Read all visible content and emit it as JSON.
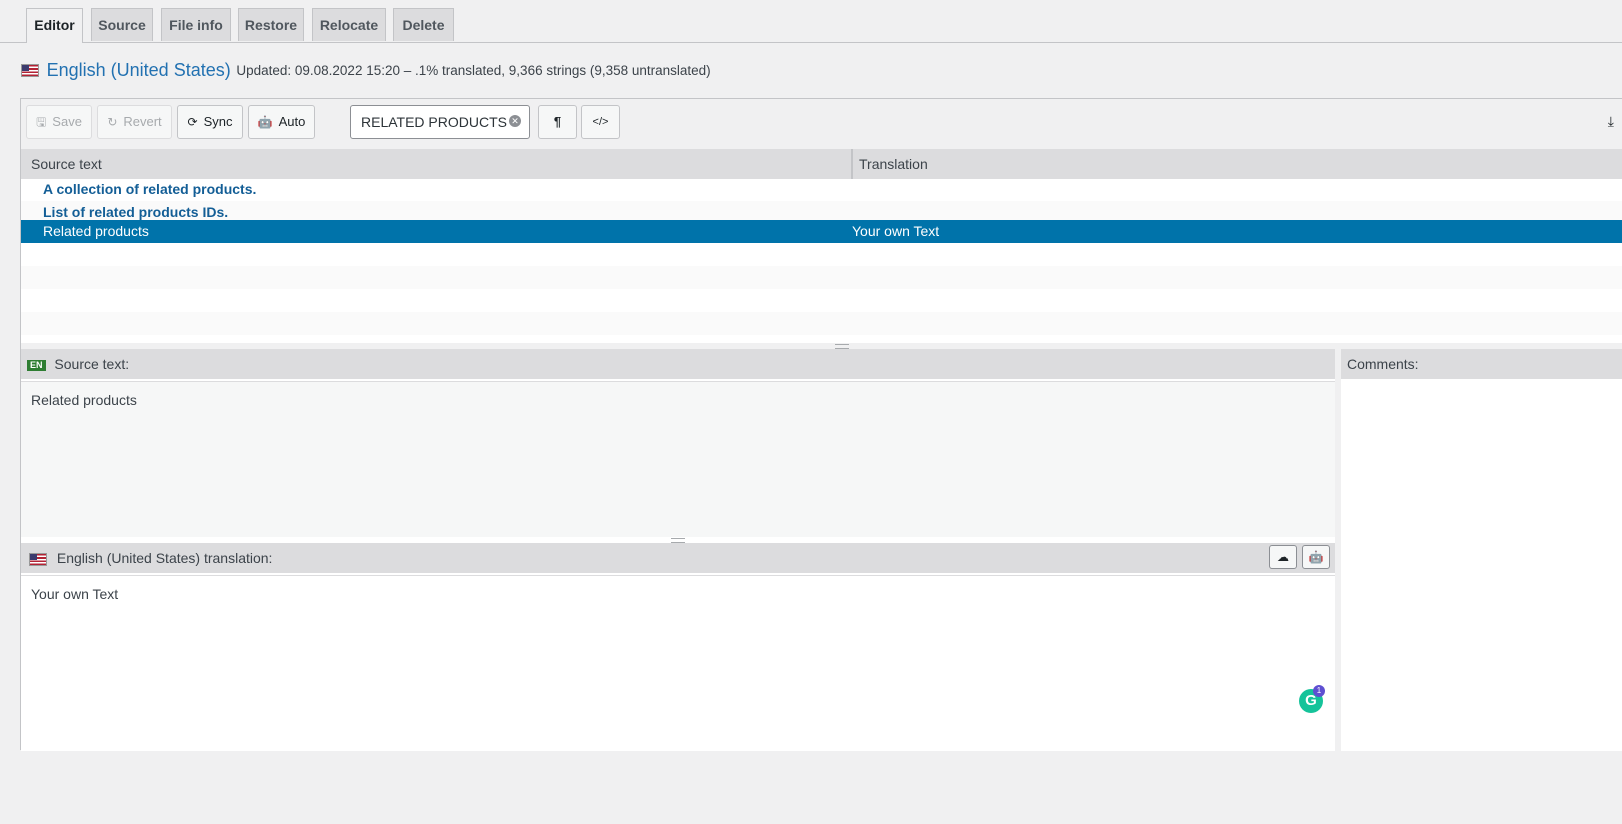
{
  "tabs": [
    {
      "label": "Editor",
      "active": true
    },
    {
      "label": "Source"
    },
    {
      "label": "File info"
    },
    {
      "label": "Restore"
    },
    {
      "label": "Relocate"
    },
    {
      "label": "Delete"
    }
  ],
  "header": {
    "locale_name": "English (United States)",
    "meta": "Updated: 09.08.2022 15:20 – .1% translated, 9,366 strings (9,358 untranslated)"
  },
  "toolbar": {
    "save_label": "Save",
    "revert_label": "Revert",
    "sync_label": "Sync",
    "auto_label": "Auto",
    "search_value": "RELATED PRODUCTS",
    "pilcrow_label": "¶",
    "code_label": "</>"
  },
  "list": {
    "col_source": "Source text",
    "col_translation": "Translation",
    "rows": [
      {
        "source": "A collection of related products.",
        "translation": ""
      },
      {
        "source": "List of related products IDs.",
        "translation": ""
      },
      {
        "source": "Related products",
        "translation": "Your own Text"
      }
    ]
  },
  "source_pane": {
    "badge": "EN",
    "label": "Source text:",
    "text": "Related products"
  },
  "translation_pane": {
    "label": "English (United States) translation:",
    "text": "Your own Text"
  },
  "comments_pane": {
    "label": "Comments:"
  },
  "grammarly": {
    "letter": "G",
    "count": "1"
  },
  "colors": {
    "accent": "#2271b1",
    "selected_row": "#0073aa",
    "untranslated_text": "#135e96"
  }
}
